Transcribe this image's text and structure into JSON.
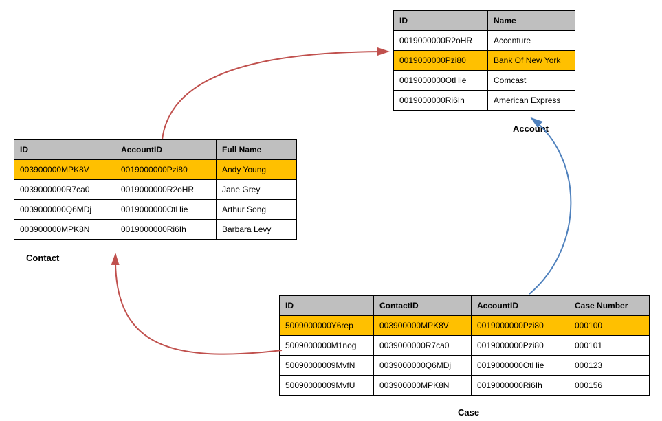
{
  "account": {
    "label": "Account",
    "headers": [
      "ID",
      "Name"
    ],
    "rows": [
      {
        "id": "0019000000R2oHR",
        "name": "Accenture",
        "hl": false
      },
      {
        "id": "0019000000Pzi80",
        "name": "Bank Of New York",
        "hl": true
      },
      {
        "id": "0019000000OtHie",
        "name": "Comcast",
        "hl": false
      },
      {
        "id": "0019000000Ri6Ih",
        "name": "American Express",
        "hl": false
      }
    ]
  },
  "contact": {
    "label": "Contact",
    "headers": [
      "ID",
      "AccountID",
      "Full Name"
    ],
    "rows": [
      {
        "id": "003900000MPK8V",
        "acc": "0019000000Pzi80",
        "name": "Andy Young",
        "hl": true
      },
      {
        "id": "0039000000R7ca0",
        "acc": "0019000000R2oHR",
        "name": "Jane Grey",
        "hl": false
      },
      {
        "id": "0039000000Q6MDj",
        "acc": "0019000000OtHie",
        "name": "Arthur Song",
        "hl": false
      },
      {
        "id": "003900000MPK8N",
        "acc": "0019000000Ri6Ih",
        "name": "Barbara Levy",
        "hl": false
      }
    ]
  },
  "case": {
    "label": "Case",
    "headers": [
      "ID",
      "ContactID",
      "AccountID",
      "Case Number"
    ],
    "rows": [
      {
        "id": "5009000000Y6rep",
        "con": "003900000MPK8V",
        "acc": "0019000000Pzi80",
        "num": "000100",
        "hl": true
      },
      {
        "id": "5009000000M1nog",
        "con": "0039000000R7ca0",
        "acc": "0019000000Pzi80",
        "num": "000101",
        "hl": false
      },
      {
        "id": "50090000009MvfN",
        "con": "0039000000Q6MDj",
        "acc": "0019000000OtHie",
        "num": "000123",
        "hl": false
      },
      {
        "id": "50090000009MvfU",
        "con": "003900000MPK8N",
        "acc": "0019000000Ri6Ih",
        "num": "000156",
        "hl": false
      }
    ]
  }
}
